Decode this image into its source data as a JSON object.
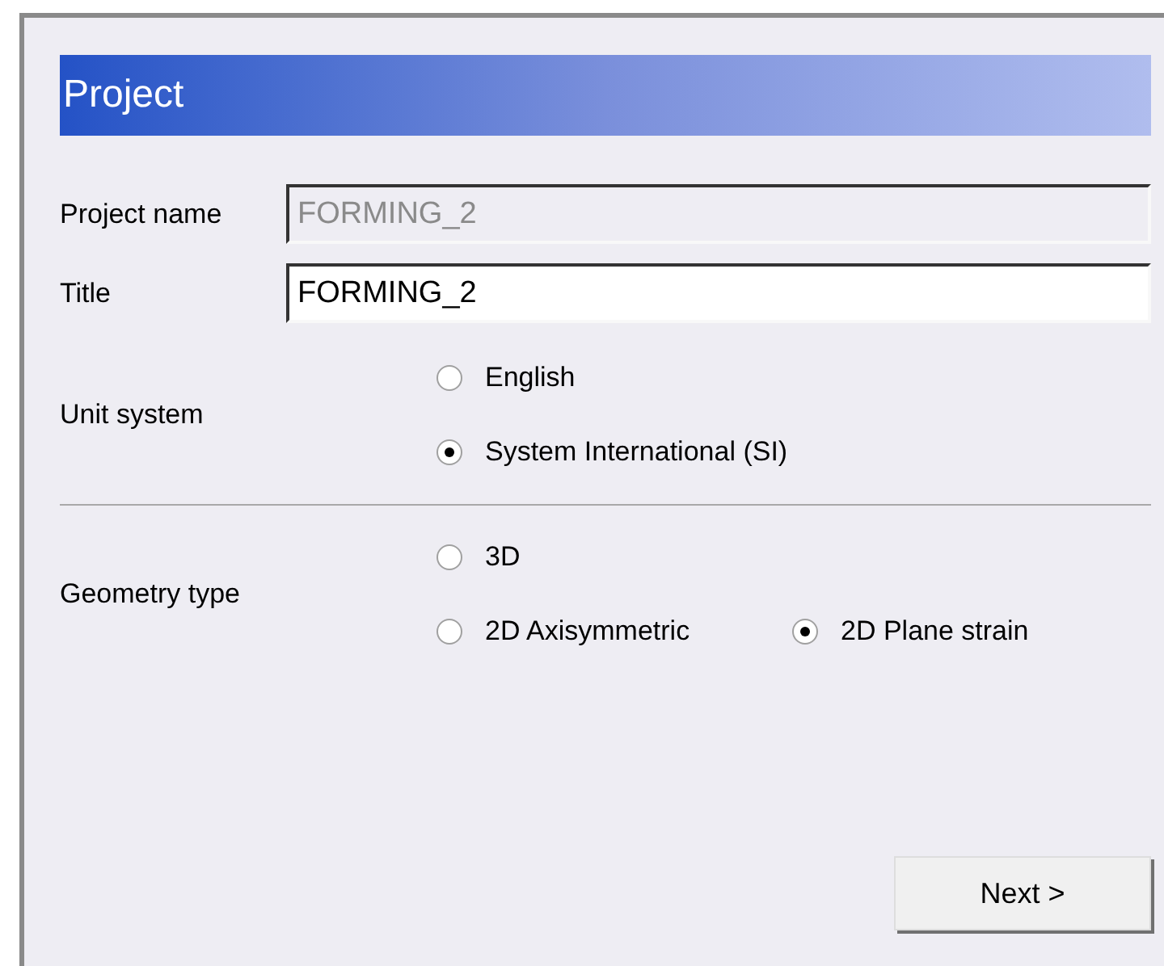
{
  "header": {
    "title": "Project"
  },
  "fields": [
    {
      "label": "Project name",
      "value": "FORMING_2",
      "disabled": true
    },
    {
      "label": "Title",
      "value": "FORMING_2",
      "disabled": false
    }
  ],
  "groups": [
    {
      "label": "Unit system",
      "rows": [
        [
          {
            "label": "English",
            "selected": false
          }
        ],
        [
          {
            "label": "System International (SI)",
            "selected": true
          }
        ]
      ]
    },
    {
      "label": "Geometry type",
      "rows": [
        [
          {
            "label": "3D",
            "selected": false
          }
        ],
        [
          {
            "label": "2D Axisymmetric",
            "selected": false
          },
          {
            "label": "2D Plane strain",
            "selected": true
          }
        ]
      ]
    }
  ],
  "buttons": [
    "Next >"
  ]
}
